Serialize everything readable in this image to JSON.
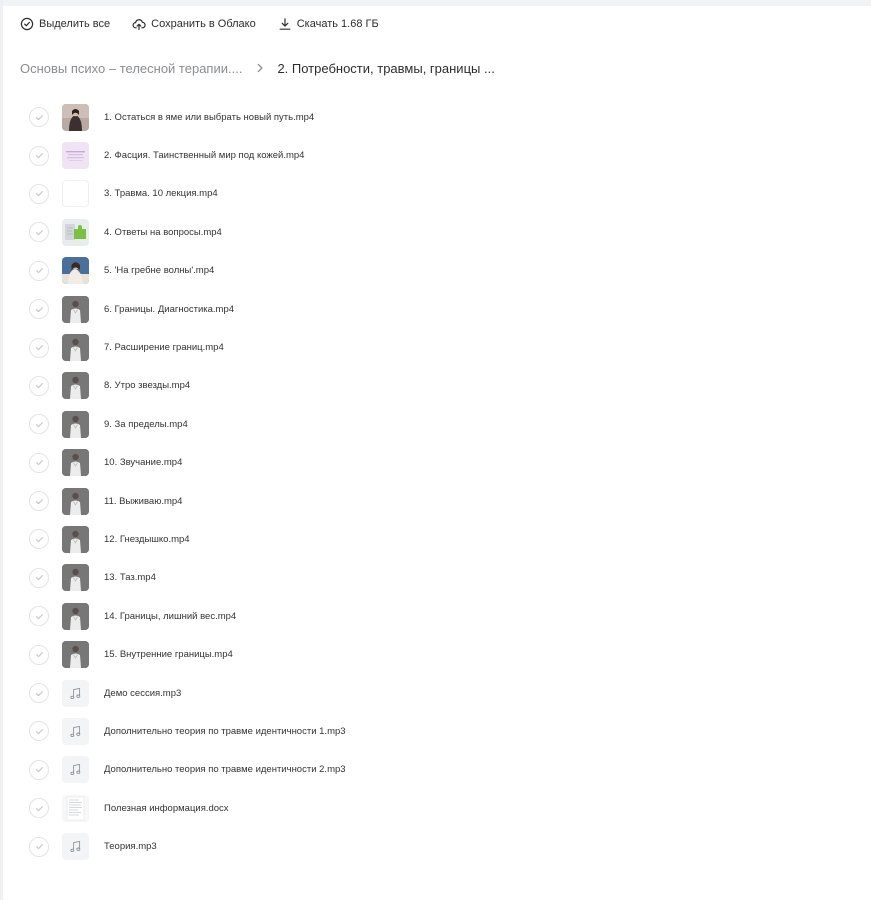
{
  "toolbar": {
    "select_all": "Выделить все",
    "save_to_cloud": "Сохранить в Облако",
    "download": "Скачать 1.68 ГБ"
  },
  "breadcrumb": {
    "parent": "Основы психо – телесной терапии....",
    "current": "2. Потребности, травмы, границы ..."
  },
  "files": [
    {
      "name": "1. Остаться в яме или выбрать новый путь.mp4",
      "thumb": "video-portrait-dark"
    },
    {
      "name": "2. Фасция. Таинственный мир под кожей.mp4",
      "thumb": "video-slide-lilac"
    },
    {
      "name": "3. Травма. 10 лекция.mp4",
      "thumb": "blank"
    },
    {
      "name": "4. Ответы на вопросы.mp4",
      "thumb": "video-puzzle"
    },
    {
      "name": "5. 'На гребне волны'.mp4",
      "thumb": "video-portrait-color"
    },
    {
      "name": "6. Границы. Диагностика.mp4",
      "thumb": "video-portrait-gray"
    },
    {
      "name": "7. Расширение границ.mp4",
      "thumb": "video-portrait-gray"
    },
    {
      "name": "8. Утро звезды.mp4",
      "thumb": "video-portrait-gray"
    },
    {
      "name": "9. За пределы.mp4",
      "thumb": "video-portrait-gray"
    },
    {
      "name": "10. Звучание.mp4",
      "thumb": "video-portrait-gray"
    },
    {
      "name": "11. Выживаю.mp4",
      "thumb": "video-portrait-gray"
    },
    {
      "name": "12. Гнездышко.mp4",
      "thumb": "video-portrait-gray"
    },
    {
      "name": "13. Таз.mp4",
      "thumb": "video-portrait-gray"
    },
    {
      "name": "14. Границы, лишний вес.mp4",
      "thumb": "video-portrait-gray"
    },
    {
      "name": "15. Внутренние границы.mp4",
      "thumb": "video-portrait-gray"
    },
    {
      "name": "Демо сессия.mp3",
      "thumb": "music-note-icon"
    },
    {
      "name": "Дополнительно теория по травме идентичности 1.mp3",
      "thumb": "music-note-icon"
    },
    {
      "name": "Дополнительно теория по травме идентичности 2.mp3",
      "thumb": "music-note-icon"
    },
    {
      "name": "Полезная информация.docx",
      "thumb": "document-page"
    },
    {
      "name": "Теория.mp3",
      "thumb": "music-note-icon"
    }
  ],
  "colors": {
    "text": "#2c2d2e",
    "muted": "#8a8d91",
    "check_border": "#e3e4e7",
    "audio_bg": "#f3f4f6"
  }
}
